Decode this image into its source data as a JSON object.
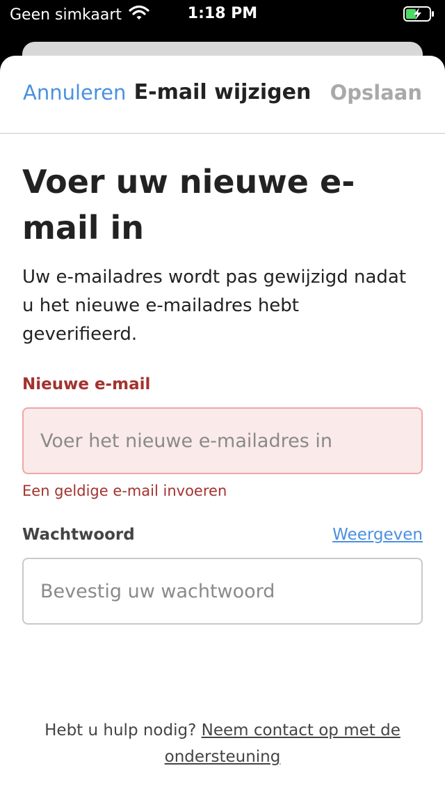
{
  "status_bar": {
    "carrier": "Geen simkaart",
    "time": "1:18 PM"
  },
  "nav": {
    "cancel_label": "Annuleren",
    "title": "E-mail wijzigen",
    "save_label": "Opslaan"
  },
  "content": {
    "heading": "Voer uw nieuwe e-mail in",
    "description": "Uw e-mailadres wordt pas gewijzigd nadat u het nieuwe e-mailadres hebt geverifieerd."
  },
  "email_field": {
    "label": "Nieuwe e-mail",
    "placeholder": "Voer het nieuwe e-mailadres in",
    "value": "",
    "error": "Een geldige e-mail invoeren"
  },
  "password_field": {
    "label": "Wachtwoord",
    "toggle_label": "Weergeven",
    "placeholder": "Bevestig uw wachtwoord",
    "value": ""
  },
  "help": {
    "prefix": "Hebt u hulp nodig?",
    "link_label": "Neem contact op met de ondersteuning"
  },
  "colors": {
    "accent": "#4a90e2",
    "error": "#a3322f",
    "error_background": "#fbeaea"
  }
}
